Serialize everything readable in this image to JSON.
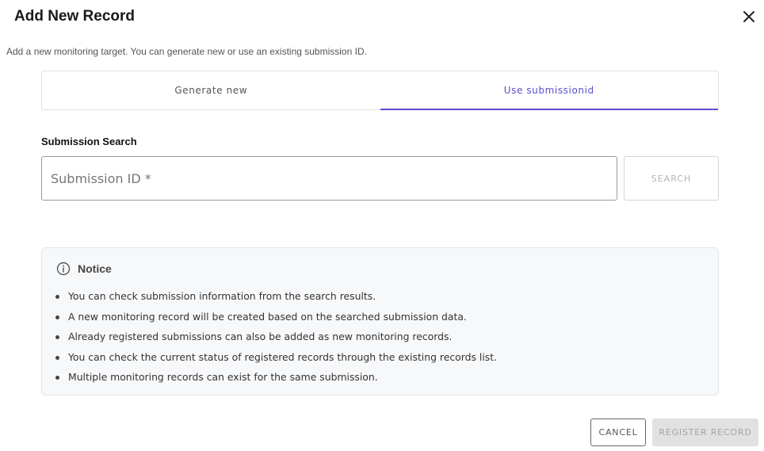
{
  "dialog": {
    "title": "Add New Record",
    "subtitle": "Add a new monitoring target. You can generate new or use an existing submission ID."
  },
  "tabs": [
    {
      "label": "Generate new",
      "active": false
    },
    {
      "label": "Use submissionid",
      "active": true
    }
  ],
  "search": {
    "section_label": "Submission Search",
    "placeholder": "Submission ID *",
    "value": "",
    "button_label": "SEARCH"
  },
  "notice": {
    "title": "Notice",
    "icon": "info-icon",
    "items": [
      "You can check submission information from the search results.",
      "A new monitoring record will be created based on the searched submission data.",
      "Already registered submissions can also be added as new monitoring records.",
      "You can check the current status of registered records through the existing records list.",
      "Multiple monitoring records can exist for the same submission."
    ]
  },
  "footer": {
    "cancel_label": "CANCEL",
    "register_label": "REGISTER RECORD"
  },
  "colors": {
    "accent": "#5b4fd0",
    "disabled_bg": "#e1e1e1",
    "notice_bg": "#f7f8fa"
  }
}
